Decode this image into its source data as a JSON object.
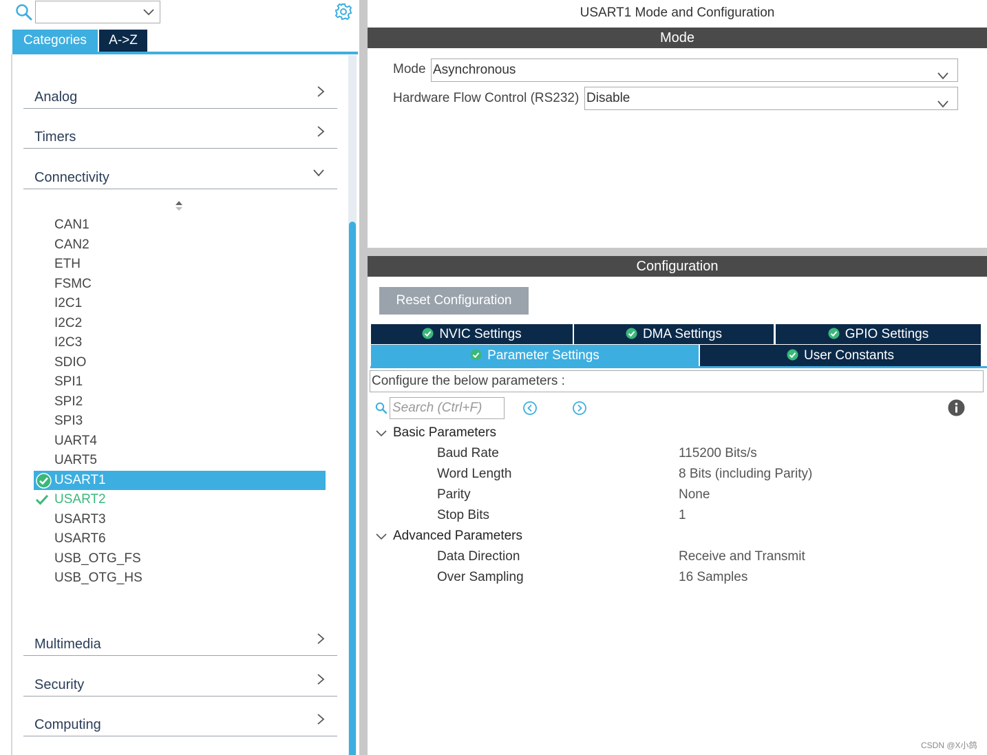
{
  "left": {
    "tabs": [
      "Categories",
      "A->Z"
    ],
    "categories_top": [
      "Analog",
      "Timers",
      "Connectivity"
    ],
    "peripherals": [
      "CAN1",
      "CAN2",
      "ETH",
      "FSMC",
      "I2C1",
      "I2C2",
      "I2C3",
      "SDIO",
      "SPI1",
      "SPI2",
      "SPI3",
      "UART4",
      "UART5",
      "USART1",
      "USART2",
      "USART3",
      "USART6",
      "USB_OTG_FS",
      "USB_OTG_HS"
    ],
    "selected_peripheral": "USART1",
    "enabled_peripheral": "USART2",
    "categories_bottom": [
      "Multimedia",
      "Security",
      "Computing"
    ]
  },
  "right": {
    "title": "USART1 Mode and Configuration",
    "mode_bar": "Mode",
    "mode_label": "Mode",
    "mode_value": "Asynchronous",
    "hfc_label": "Hardware Flow Control (RS232)",
    "hfc_value": "Disable",
    "config_bar": "Configuration",
    "reset_label": "Reset Configuration",
    "tabs_row1": [
      "NVIC Settings",
      "DMA Settings",
      "GPIO Settings"
    ],
    "tabs_row2": [
      "Parameter Settings",
      "User Constants"
    ],
    "config_note": "Configure the below parameters :",
    "search_placeholder": "Search (Ctrl+F)",
    "basic_group": "Basic Parameters",
    "basic_params": [
      {
        "name": "Baud Rate",
        "value": "115200 Bits/s"
      },
      {
        "name": "Word Length",
        "value": "8 Bits (including Parity)"
      },
      {
        "name": "Parity",
        "value": "None"
      },
      {
        "name": "Stop Bits",
        "value": "1"
      }
    ],
    "advanced_group": "Advanced Parameters",
    "advanced_params": [
      {
        "name": "Data Direction",
        "value": "Receive and Transmit"
      },
      {
        "name": "Over Sampling",
        "value": "16 Samples"
      }
    ]
  },
  "watermark": "CSDN @X小鸽",
  "colors": {
    "accent": "#3daee0",
    "navy": "#0b2a4a",
    "bar": "#4a4a4a",
    "ok_green": "#3ab87a"
  }
}
